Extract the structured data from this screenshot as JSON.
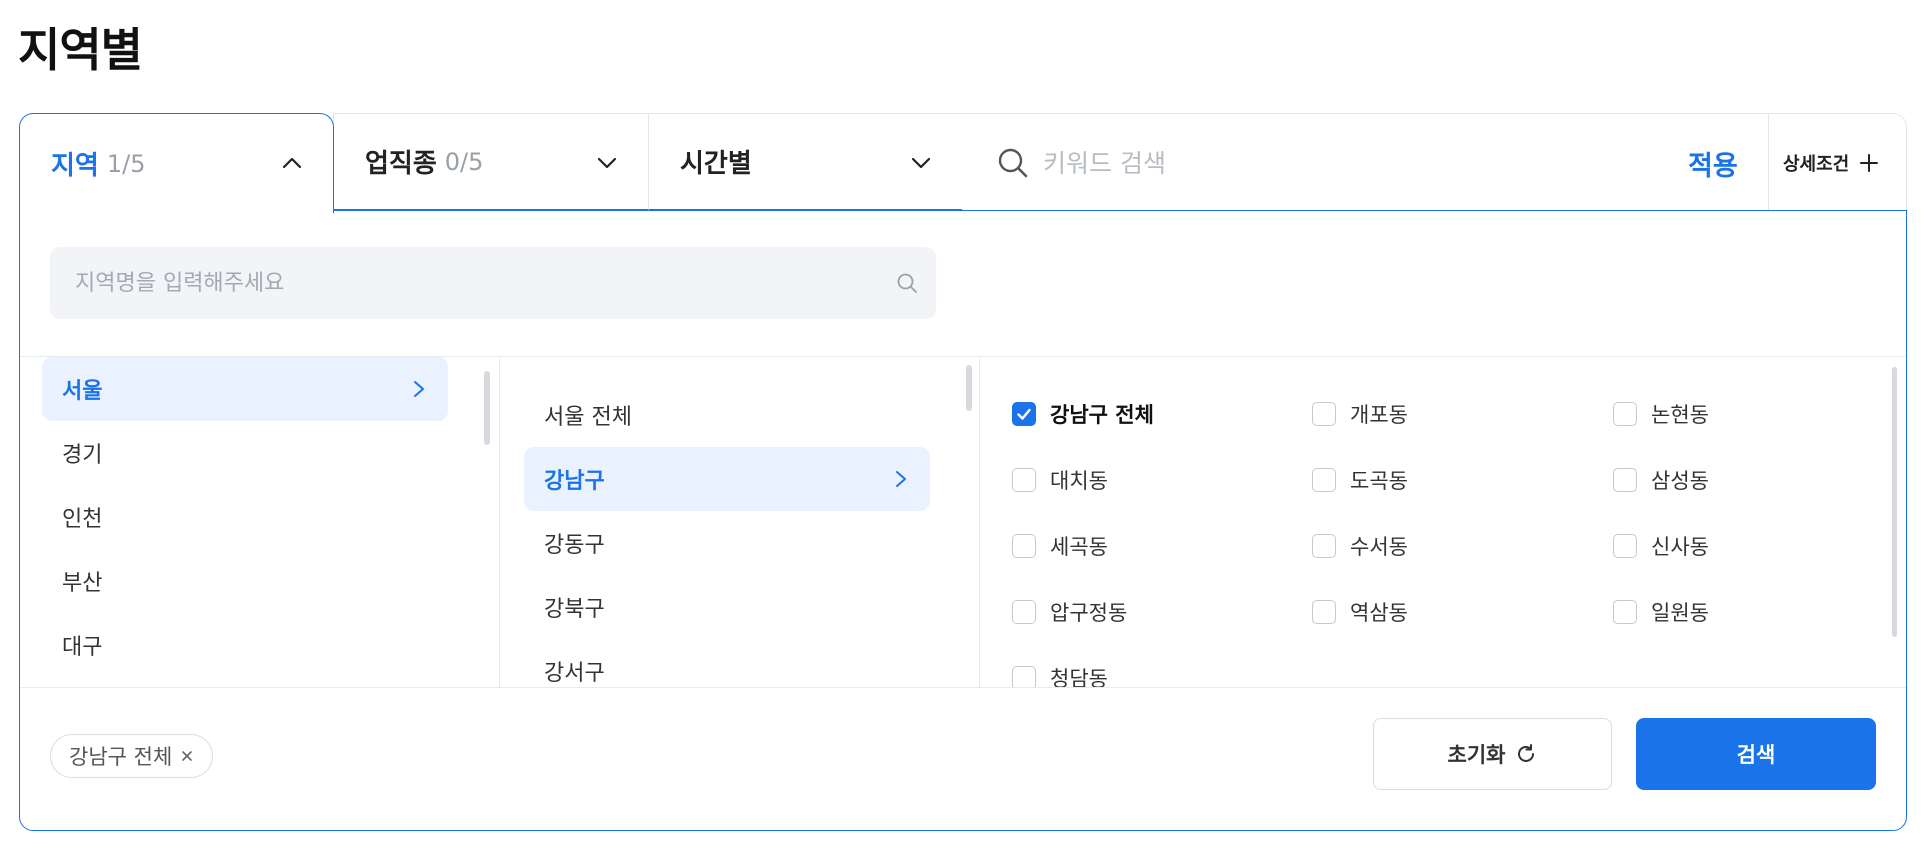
{
  "page_title": "지역별",
  "tabs": [
    {
      "label": "지역",
      "count": "1/5"
    },
    {
      "label": "업직종",
      "count": "0/5"
    },
    {
      "label": "시간별",
      "count": ""
    }
  ],
  "keyword": {
    "placeholder": "키워드 검색",
    "apply_label": "적용",
    "advanced_label": "상세조건"
  },
  "region_search": {
    "placeholder": "지역명을 입력해주세요"
  },
  "regions": [
    "서울",
    "경기",
    "인천",
    "부산",
    "대구"
  ],
  "districts": [
    "서울 전체",
    "강남구",
    "강동구",
    "강북구",
    "강서구"
  ],
  "neighborhoods": [
    "강남구 전체",
    "개포동",
    "논현동",
    "대치동",
    "도곡동",
    "삼성동",
    "세곡동",
    "수서동",
    "신사동",
    "압구정동",
    "역삼동",
    "일원동",
    "청담동"
  ],
  "selected_chip": "강남구 전체",
  "footer": {
    "reset_label": "초기화",
    "search_label": "검색"
  },
  "colors": {
    "accent": "#1a73e8",
    "selected_bg": "#eaf2ff",
    "search_bg": "#f2f4f7"
  }
}
